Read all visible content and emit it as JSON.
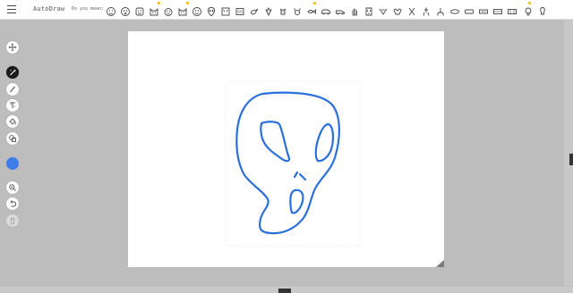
{
  "app": {
    "title": "AutoDraw"
  },
  "suggestions": {
    "prompt": "Do you mean:",
    "items": [
      "face",
      "face",
      "face",
      "cat",
      "face",
      "cat",
      "face",
      "alien",
      "alien",
      "face",
      "bird",
      "ram",
      "cow",
      "crab",
      "fish",
      "car",
      "car",
      "hand",
      "face",
      "face",
      "face",
      "scissors",
      "chair",
      "chair",
      "oval",
      "rectangle",
      "rectangle",
      "rectangle",
      "rectangle",
      "bulb",
      "bulb"
    ]
  },
  "tools": {
    "items": [
      "select",
      "autodraw",
      "draw",
      "type",
      "fill",
      "shape",
      "zoom",
      "undo",
      "delete"
    ]
  },
  "colors": {
    "current": "#3f7de8",
    "stroke": "#2b6fdc"
  }
}
